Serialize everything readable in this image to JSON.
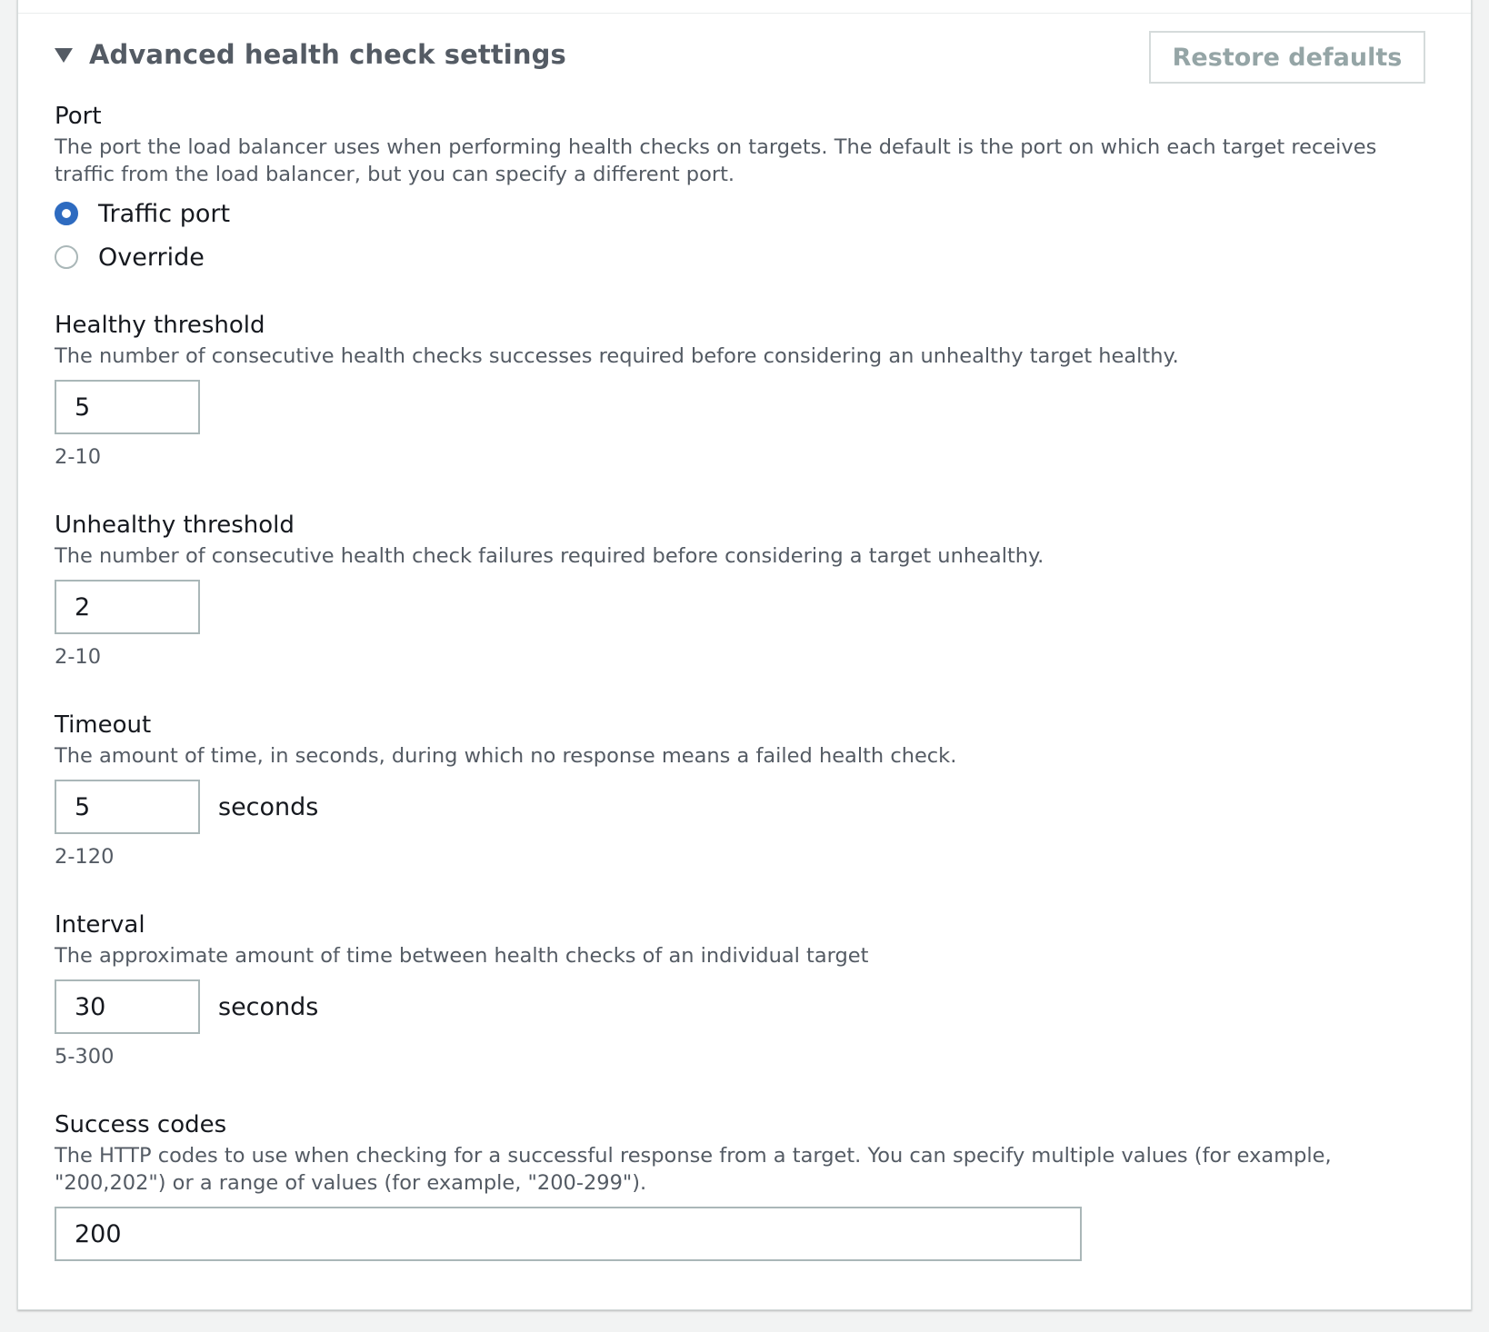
{
  "section": {
    "title": "Advanced health check settings",
    "restore_label": "Restore defaults"
  },
  "port": {
    "label": "Port",
    "description": "The port the load balancer uses when performing health checks on targets. The default is the port on which each target receives traffic from the load balancer, but you can specify a different port.",
    "options": [
      {
        "label": "Traffic port",
        "selected": true
      },
      {
        "label": "Override",
        "selected": false
      }
    ]
  },
  "healthy_threshold": {
    "label": "Healthy threshold",
    "description": "The number of consecutive health checks successes required before considering an unhealthy target healthy.",
    "value": "5",
    "constraint": "2-10"
  },
  "unhealthy_threshold": {
    "label": "Unhealthy threshold",
    "description": "The number of consecutive health check failures required before considering a target unhealthy.",
    "value": "2",
    "constraint": "2-10"
  },
  "timeout": {
    "label": "Timeout",
    "description": "The amount of time, in seconds, during which no response means a failed health check.",
    "value": "5",
    "unit": "seconds",
    "constraint": "2-120"
  },
  "interval": {
    "label": "Interval",
    "description": "The approximate amount of time between health checks of an individual target",
    "value": "30",
    "unit": "seconds",
    "constraint": "5-300"
  },
  "success_codes": {
    "label": "Success codes",
    "description": "The HTTP codes to use when checking for a successful response from a target. You can specify multiple values (for example, \"200,202\") or a range of values (for example, \"200-299\").",
    "value": "200"
  },
  "colors": {
    "radio_selected": "#2e6bc0",
    "muted_text": "#545b64",
    "disabled_text": "#95a5a6",
    "border": "#aab7b8"
  }
}
